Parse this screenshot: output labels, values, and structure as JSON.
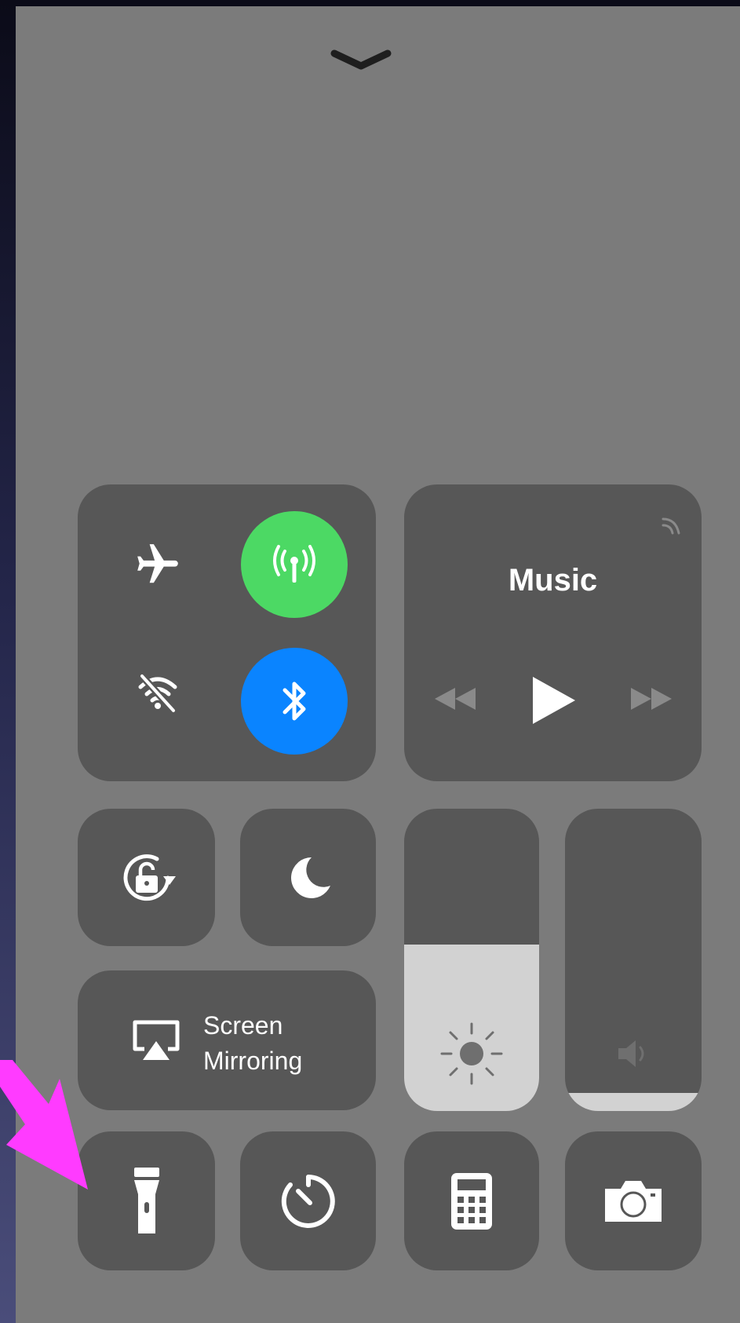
{
  "control_center": {
    "collapse_icon": "chevron-down-icon",
    "connectivity": {
      "airplane_mode": {
        "icon": "airplane-icon",
        "on": false
      },
      "cellular_data": {
        "icon": "antenna-icon",
        "on": true,
        "color": "#4cd964"
      },
      "wifi": {
        "icon": "wifi-off-icon",
        "on": false
      },
      "bluetooth": {
        "icon": "bluetooth-icon",
        "on": true,
        "color": "#0a84ff"
      }
    },
    "music": {
      "title": "Music",
      "airplay_icon": "airplay-audio-icon",
      "controls": [
        "rewind-icon",
        "play-icon",
        "fast-forward-icon"
      ]
    },
    "orientation_lock": {
      "icon": "orientation-lock-icon"
    },
    "do_not_disturb": {
      "icon": "moon-icon"
    },
    "screen_mirroring": {
      "label_line1": "Screen",
      "label_line2": "Mirroring",
      "icon": "airplay-screen-icon"
    },
    "brightness": {
      "icon": "sun-icon",
      "level": 0.55
    },
    "volume": {
      "icon": "speaker-icon",
      "level": 0.06
    },
    "bottom_row": [
      "flashlight-icon",
      "timer-icon",
      "calculator-icon",
      "camera-icon"
    ],
    "annotation": {
      "type": "arrow",
      "color": "#ff3bff"
    }
  }
}
